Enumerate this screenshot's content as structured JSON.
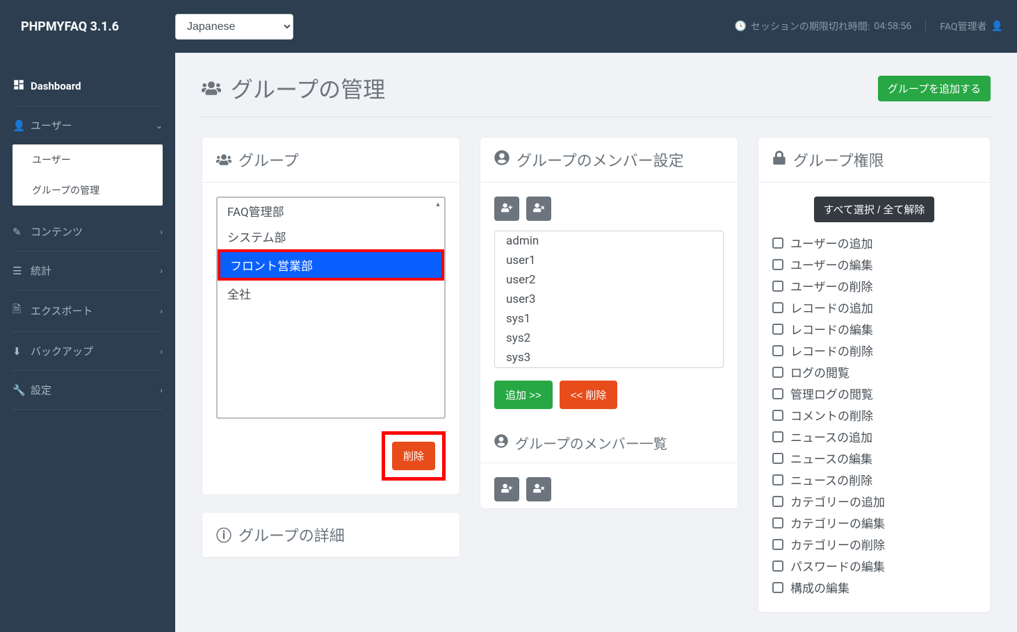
{
  "brand": "PHPMYFAQ 3.1.6",
  "language": "Japanese",
  "session": {
    "label": "セッションの期限切れ時間:",
    "time": "04:58:56"
  },
  "admin": "FAQ管理者",
  "sidebar": {
    "dashboard": "Dashboard",
    "items": [
      {
        "label": "ユーザー",
        "expanded": true,
        "submenu": [
          "ユーザー",
          "グループの管理"
        ]
      },
      {
        "label": "コンテンツ"
      },
      {
        "label": "統計"
      },
      {
        "label": "エクスポート"
      },
      {
        "label": "バックアップ"
      },
      {
        "label": "設定"
      }
    ]
  },
  "page": {
    "title": "グループの管理",
    "add_group": "グループを追加する"
  },
  "groups": {
    "header": "グループ",
    "items": [
      "FAQ管理部",
      "システム部",
      "フロント営業部",
      "全社"
    ],
    "selected_index": 2,
    "delete": "削除",
    "details_header": "グループの詳細"
  },
  "members": {
    "header": "グループのメンバー設定",
    "users": [
      "admin",
      "user1",
      "user2",
      "user3",
      "sys1",
      "sys2",
      "sys3"
    ],
    "add": "追加 >>",
    "remove": "<< 削除",
    "list_header": "グループのメンバー一覧"
  },
  "perms": {
    "header": "グループ権限",
    "toggle": "すべて選択 / 全て解除",
    "items": [
      "ユーザーの追加",
      "ユーザーの編集",
      "ユーザーの削除",
      "レコードの追加",
      "レコードの編集",
      "レコードの削除",
      "ログの閲覧",
      "管理ログの閲覧",
      "コメントの削除",
      "ニュースの追加",
      "ニュースの編集",
      "ニュースの削除",
      "カテゴリーの追加",
      "カテゴリーの編集",
      "カテゴリーの削除",
      "パスワードの編集",
      "構成の編集"
    ]
  }
}
